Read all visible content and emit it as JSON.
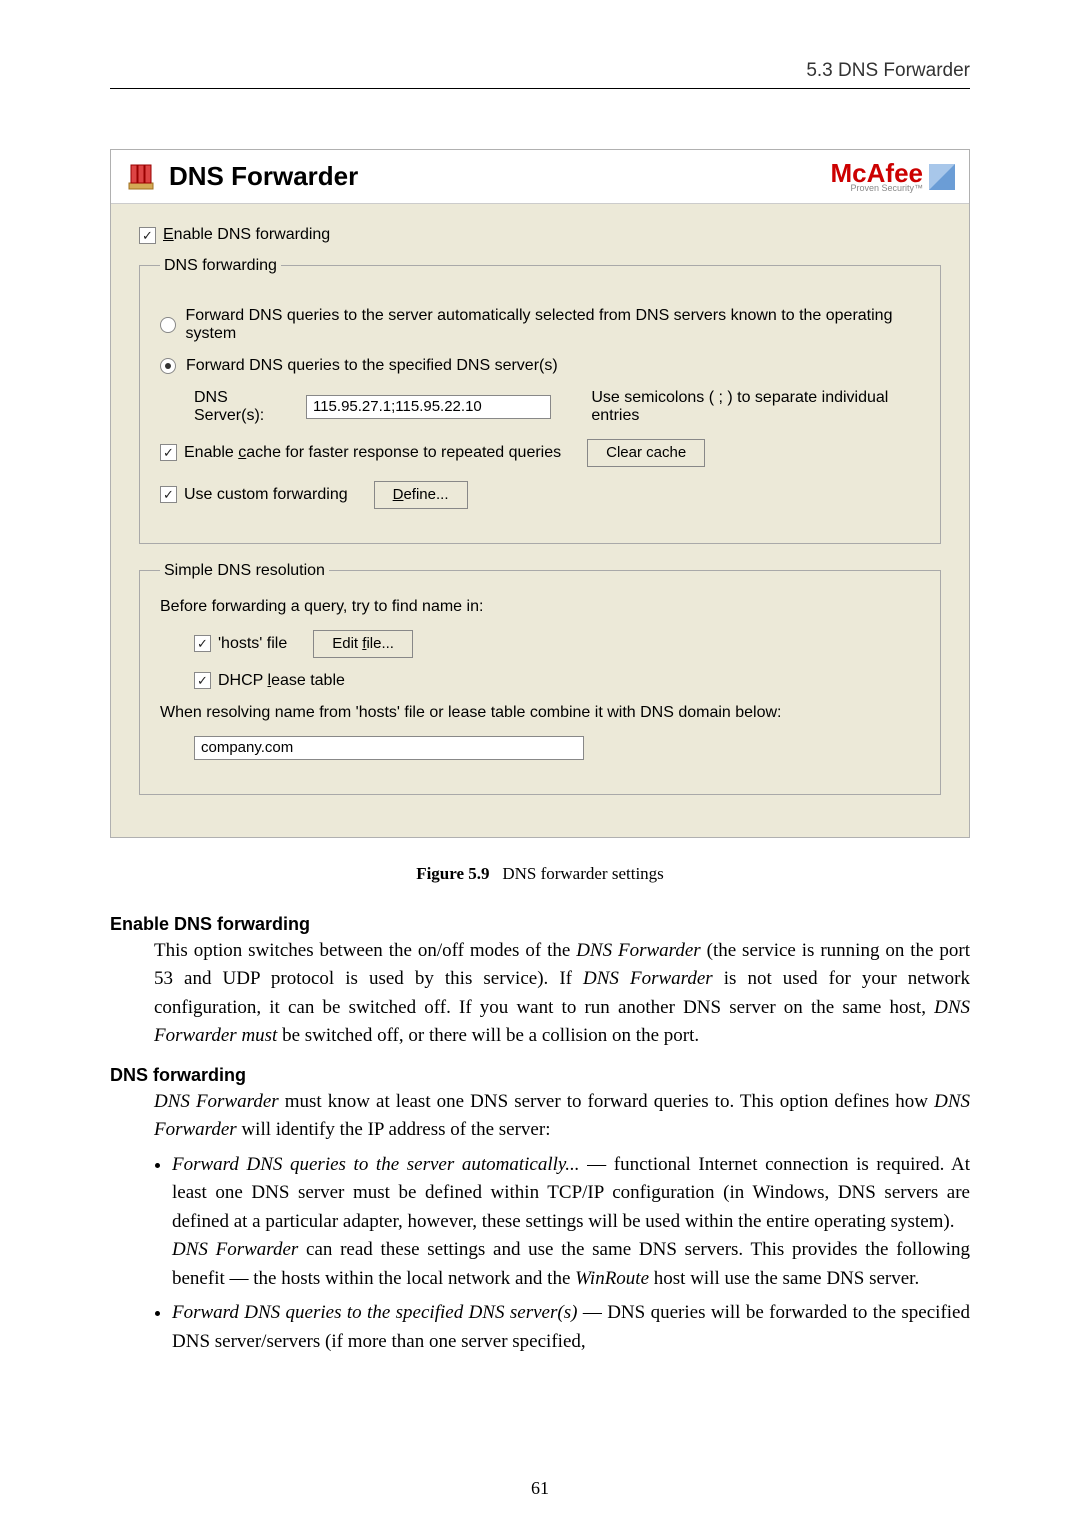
{
  "header": {
    "section_label": "5.3  DNS Forwarder"
  },
  "dialog": {
    "title": "DNS Forwarder",
    "brand": {
      "name": "McAfee",
      "tagline": "Proven Security™"
    },
    "enable_label": "Enable DNS forwarding",
    "enable_key": "E",
    "group1_legend": "DNS forwarding",
    "radio1": "Forward DNS queries to the server automatically selected from DNS servers known to the operating system",
    "radio2": "Forward DNS queries to the specified DNS server(s)",
    "servers_label": "DNS Server(s):",
    "servers_value": "115.95.27.1;115.95.22.10",
    "servers_hint": "Use semicolons ( ; ) to separate individual entries",
    "cache_label_prefix": "Enable ",
    "cache_label_key": "c",
    "cache_label_suffix": "ache for faster response to repeated queries",
    "clear_cache": "Clear cache",
    "custom_fwd_label": "Use custom forwarding",
    "define_btn_key": "D",
    "define_btn_rest": "efine...",
    "group2_legend": "Simple DNS resolution",
    "before_text": "Before forwarding a query, try to find name in:",
    "hosts_label": "'hosts' file",
    "edit_file_prefix": "Edit ",
    "edit_file_key": "f",
    "edit_file_suffix": "ile...",
    "dhcp_prefix": "DHCP ",
    "dhcp_key": "l",
    "dhcp_suffix": "ease table",
    "combine_text": "When resolving name from 'hosts' file or lease table combine it with DNS domain below:",
    "domain_value": "company.com"
  },
  "figure": {
    "label": "Figure 5.9",
    "caption": "DNS forwarder settings"
  },
  "terms": {
    "t1": "Enable DNS forwarding",
    "t1_body": "This option switches between the on/off modes of the <em>DNS Forwarder</em> (the service is running on the port 53 and UDP protocol is used by this service). If <em>DNS Forwarder</em> is not used for your network configuration, it can be switched off. If you want to run another DNS server on the same host, <em>DNS Forwarder must</em> be switched off, or there will be a collision on the port.",
    "t2": "DNS forwarding",
    "t2_body": "<em>DNS Forwarder</em> must know at least one DNS server to forward queries to. This option defines how <em>DNS Forwarder</em> will identify the IP address of the server:",
    "bullet1": "<em>Forward DNS queries to the server automatically...</em> — functional Internet connection is required. At least one DNS server must be defined within TCP/IP configuration (in Windows, DNS servers are defined at a particular adapter, however, these settings will be used within the entire operating system).<br><em>DNS Forwarder</em> can read these settings and use the same DNS servers. This provides the following benefit — the hosts within the local network and the <em>WinRoute</em> host will use the same DNS server.",
    "bullet2": "<em>Forward DNS queries to the specified DNS server(s)</em> — DNS queries will be forwarded to the specified DNS server/servers (if more than one server specified,"
  },
  "page_number": "61"
}
